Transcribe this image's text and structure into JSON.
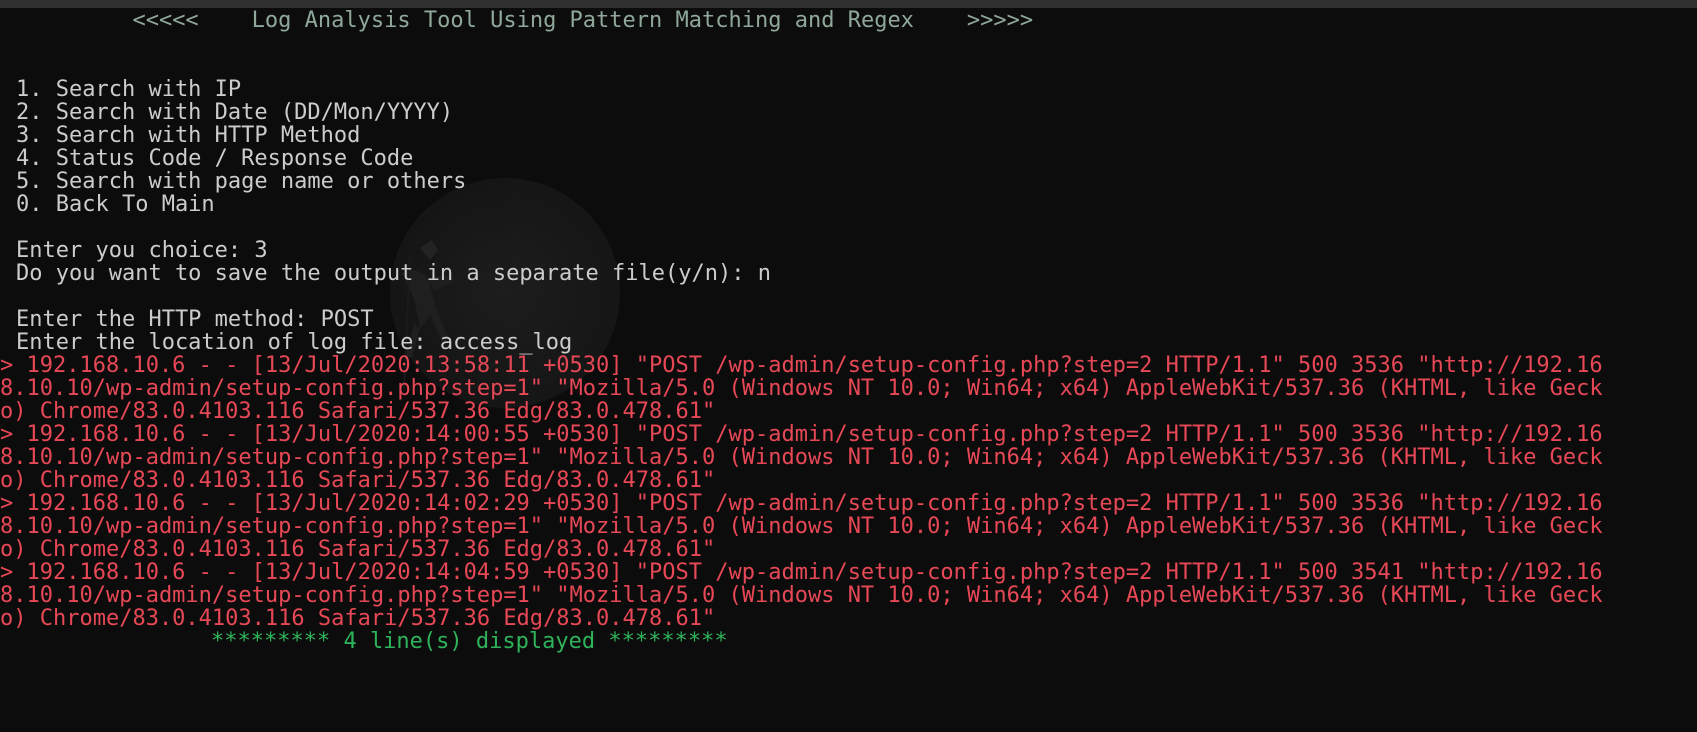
{
  "header": {
    "left_arrows": "<<<<<",
    "title": "Log Analysis Tool Using Pattern Matching and Regex",
    "right_arrows": ">>>>>"
  },
  "menu": {
    "items": [
      "1. Search with IP",
      "2. Search with Date (DD/Mon/YYYY)",
      "3. Search with HTTP Method",
      "4. Status Code / Response Code",
      "5. Search with page name or others",
      "0. Back To Main"
    ]
  },
  "prompts": {
    "choice": "Enter you choice: 3",
    "save_output": "Do you want to save the output in a separate file(y/n): n",
    "http_method": "Enter the HTTP method: POST",
    "log_location": "Enter the location of log file: access_log"
  },
  "results": {
    "lines": [
      "> 192.168.10.6 - - [13/Jul/2020:13:58:11 +0530] \"POST /wp-admin/setup-config.php?step=2 HTTP/1.1\" 500 3536 \"http://192.16",
      "8.10.10/wp-admin/setup-config.php?step=1\" \"Mozilla/5.0 (Windows NT 10.0; Win64; x64) AppleWebKit/537.36 (KHTML, like Geck",
      "o) Chrome/83.0.4103.116 Safari/537.36 Edg/83.0.478.61\"",
      "> 192.168.10.6 - - [13/Jul/2020:14:00:55 +0530] \"POST /wp-admin/setup-config.php?step=2 HTTP/1.1\" 500 3536 \"http://192.16",
      "8.10.10/wp-admin/setup-config.php?step=1\" \"Mozilla/5.0 (Windows NT 10.0; Win64; x64) AppleWebKit/537.36 (KHTML, like Geck",
      "o) Chrome/83.0.4103.116 Safari/537.36 Edg/83.0.478.61\"",
      "> 192.168.10.6 - - [13/Jul/2020:14:02:29 +0530] \"POST /wp-admin/setup-config.php?step=2 HTTP/1.1\" 500 3536 \"http://192.16",
      "8.10.10/wp-admin/setup-config.php?step=1\" \"Mozilla/5.0 (Windows NT 10.0; Win64; x64) AppleWebKit/537.36 (KHTML, like Geck",
      "o) Chrome/83.0.4103.116 Safari/537.36 Edg/83.0.478.61\"",
      "> 192.168.10.6 - - [13/Jul/2020:14:04:59 +0530] \"POST /wp-admin/setup-config.php?step=2 HTTP/1.1\" 500 3541 \"http://192.16",
      "8.10.10/wp-admin/setup-config.php?step=1\" \"Mozilla/5.0 (Windows NT 10.0; Win64; x64) AppleWebKit/537.36 (KHTML, like Geck",
      "o) Chrome/83.0.4103.116 Safari/537.36 Edg/83.0.478.61\""
    ],
    "summary": "********* 4 line(s) displayed *********"
  },
  "colors": {
    "background": "#0c0c0c",
    "text": "#cccccc",
    "header": "#8fa89a",
    "match": "#e74856",
    "summary": "#2fb35a"
  }
}
